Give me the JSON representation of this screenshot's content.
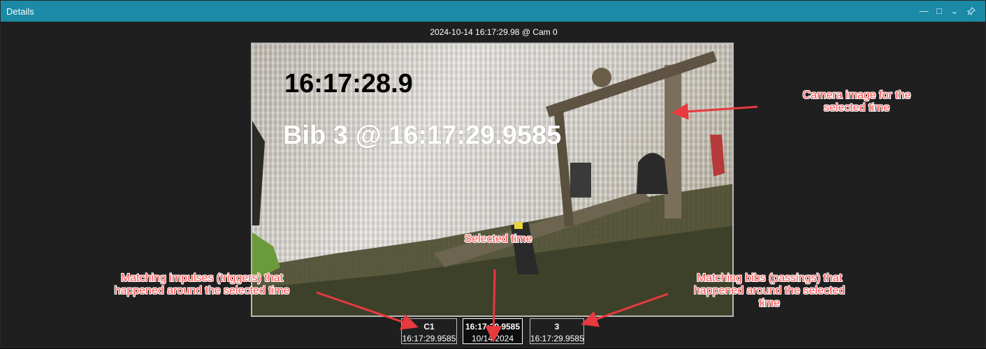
{
  "window": {
    "title": "Details",
    "controls": [
      "minimize-icon",
      "maximize-icon",
      "chevron-down-icon",
      "pin-icon"
    ],
    "accent": "#1a8aa6"
  },
  "camera": {
    "header": "2024-10-14 16:17:29.98 @ Cam 0",
    "overlay_time": "16:17:28.9",
    "overlay_bib": "Bib 3 @ 16:17:29.9585"
  },
  "strip": {
    "impulse": {
      "top": "C1",
      "bottom": "16:17:29.9585"
    },
    "selected": {
      "top": "16:17:29.9585",
      "bottom": "10/14/2024"
    },
    "bib": {
      "top": "3",
      "bottom": "16:17:29.9585"
    }
  },
  "annotations": {
    "camera_line1": "Camera image for the",
    "camera_line2": "selected time",
    "selected": "Selected time",
    "impulses_line1": "Matching impulses (triggers) that",
    "impulses_line2": "happened around the selected time",
    "bibs_line1": "Matching bibs (passings) that",
    "bibs_line2": "happened around the selected",
    "bibs_line3": "time",
    "color": "#ff4d4d"
  }
}
